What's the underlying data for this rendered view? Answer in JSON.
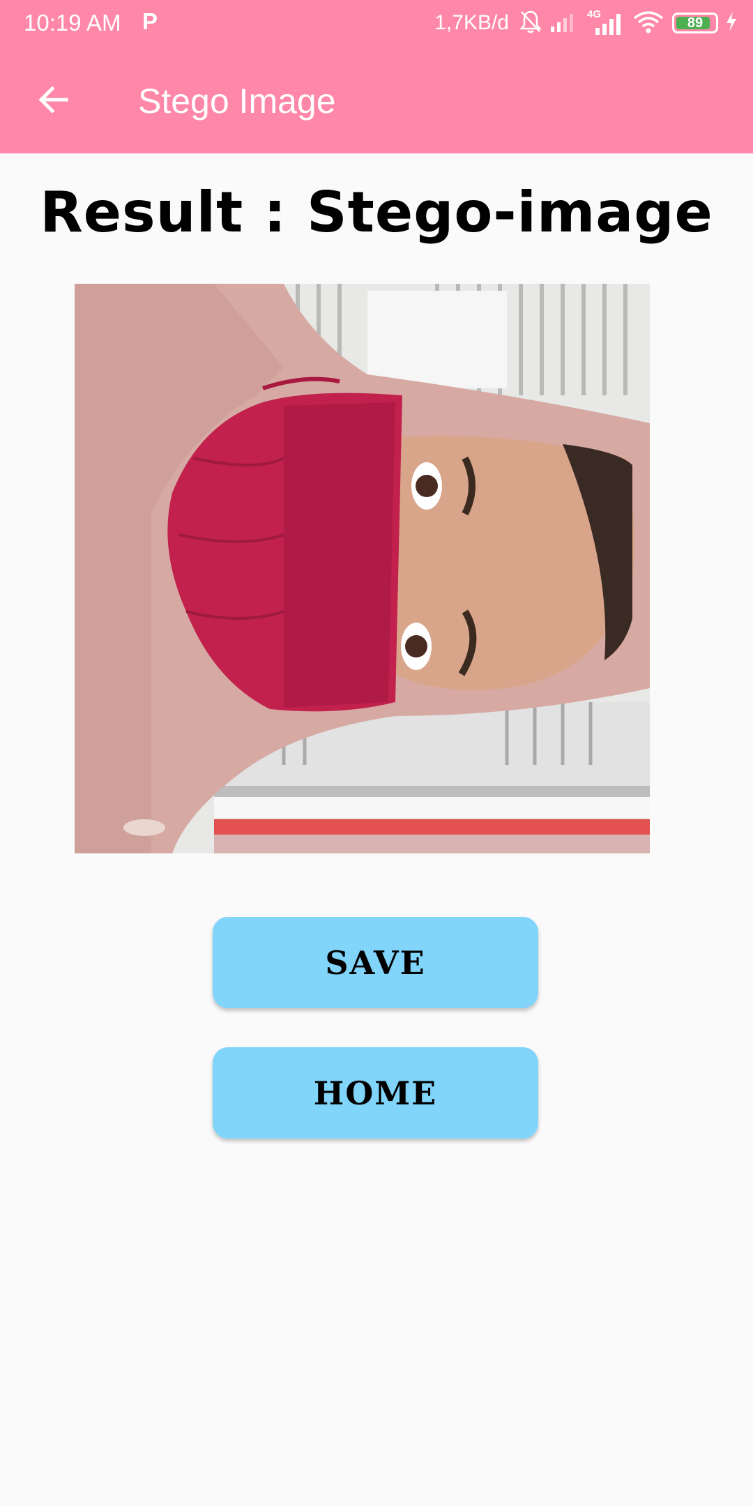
{
  "status_bar": {
    "time": "10:19 AM",
    "app_indicator": "P",
    "network_speed": "1,7KB/d",
    "network_type": "4G",
    "battery_level": "89",
    "battery_percent_value": 0.89,
    "icons": [
      "mute-icon",
      "signal-icon",
      "signal-4g-icon",
      "wifi-icon",
      "battery-icon",
      "charging-icon"
    ]
  },
  "app_bar": {
    "title": "Stego Image",
    "back_icon": "arrow-left-icon"
  },
  "main": {
    "heading": "Result : Stego-image",
    "save_label": "SAVE",
    "home_label": "HOME"
  },
  "colors": {
    "app_bar": "#ff87a7",
    "button": "#81d4fa",
    "background": "#fafafa"
  }
}
